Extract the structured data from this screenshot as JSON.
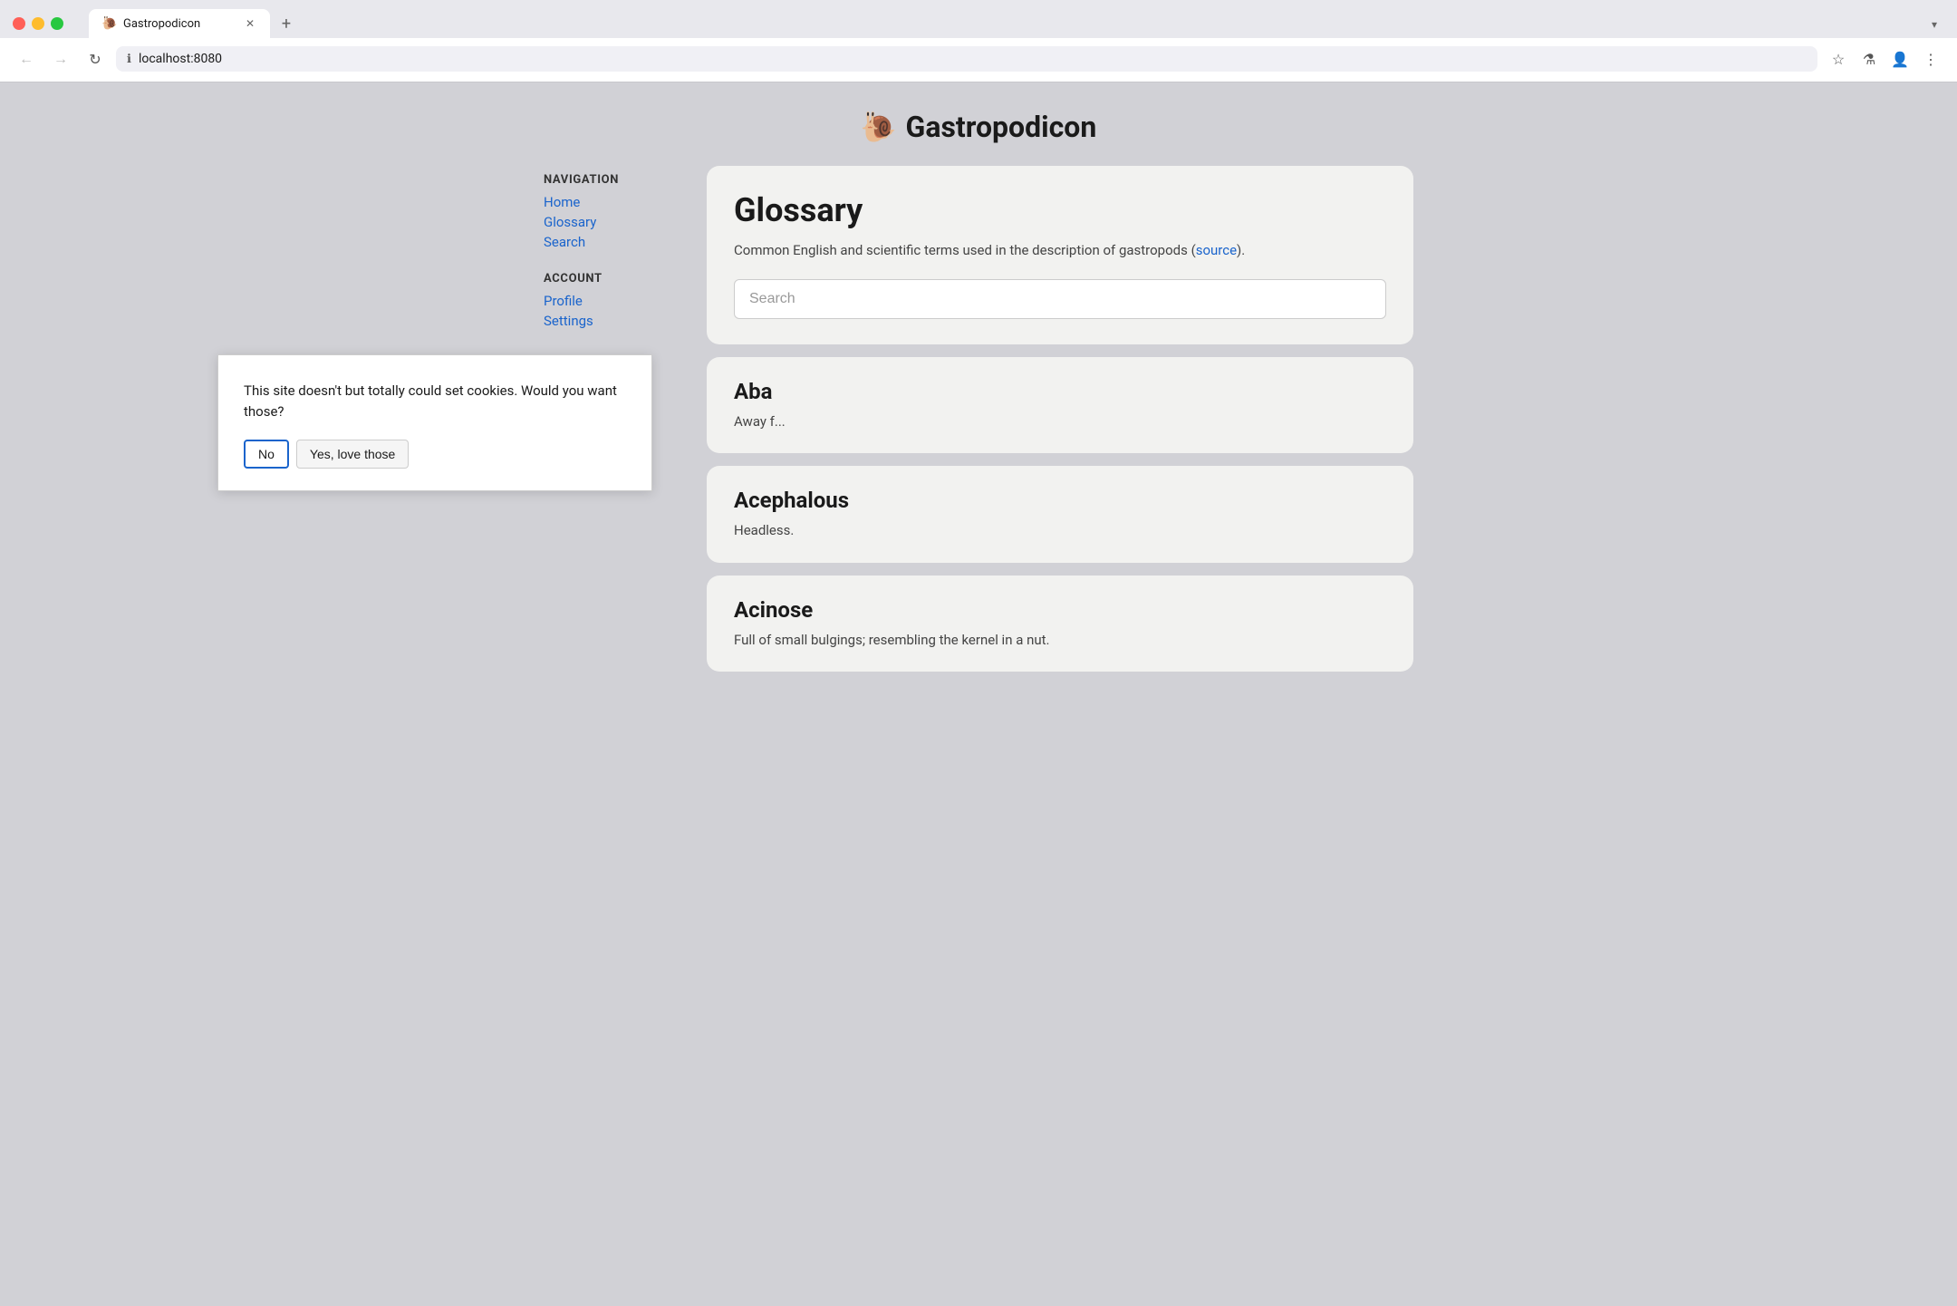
{
  "browser": {
    "tab_title": "Gastropodicon",
    "tab_favicon": "🐌",
    "url": "localhost:8080",
    "new_tab_label": "+",
    "dropdown_label": "▾"
  },
  "nav_buttons": {
    "back": "←",
    "forward": "→",
    "refresh": "↻",
    "lock_icon": "🔒",
    "star_icon": "☆",
    "flask_icon": "⚗",
    "user_icon": "👤",
    "menu_icon": "⋮"
  },
  "site": {
    "logo": "🐌",
    "title": "Gastropodicon"
  },
  "sidebar": {
    "nav_section_title": "NAVIGATION",
    "nav_links": [
      {
        "label": "Home",
        "href": "#"
      },
      {
        "label": "Glossary",
        "href": "#"
      },
      {
        "label": "Search",
        "href": "#"
      }
    ],
    "account_section_title": "ACCOUNT",
    "account_links": [
      {
        "label": "Profile",
        "href": "#"
      },
      {
        "label": "Settings",
        "href": "#"
      }
    ]
  },
  "glossary": {
    "title": "Glossary",
    "description_text": "Common English and scientific terms used in the description of gastropods (",
    "source_link_text": "source",
    "description_end": ").",
    "search_placeholder": "Search"
  },
  "terms": [
    {
      "title": "Aba",
      "definition": "Away f..."
    },
    {
      "title": "Acephalous",
      "definition": "Headless."
    },
    {
      "title": "Acinose",
      "definition": "Full of small bulgings; resembling the kernel in a nut."
    }
  ],
  "cookie_dialog": {
    "message": "This site doesn't but totally could set cookies. Would you want those?",
    "btn_no_label": "No",
    "btn_yes_label": "Yes, love those"
  }
}
